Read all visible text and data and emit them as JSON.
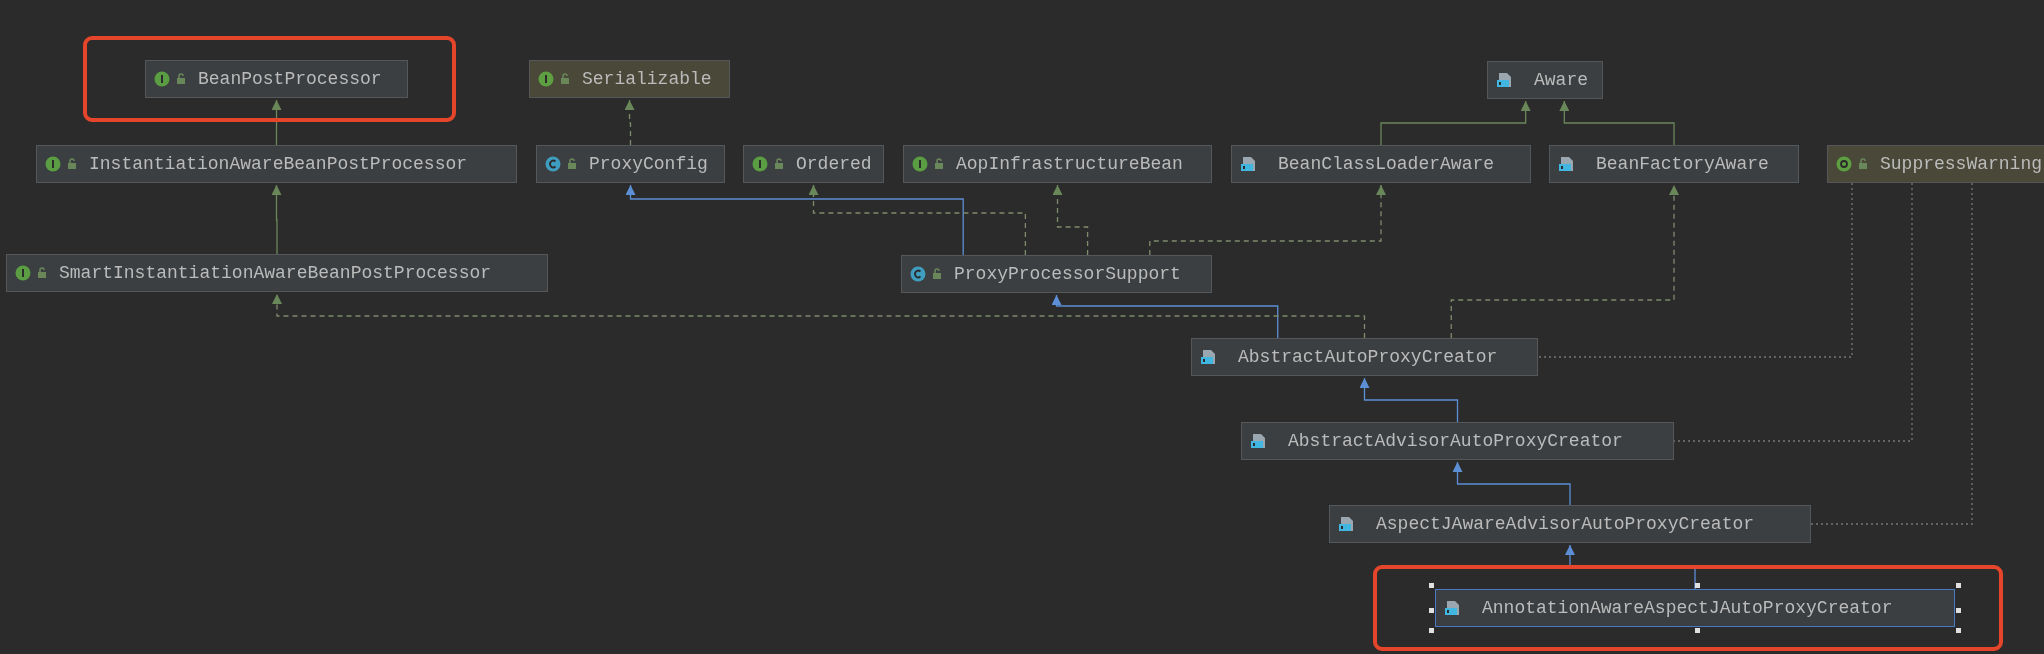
{
  "diagram": {
    "nodes": [
      {
        "name": "BeanPostProcessor",
        "kind": "interface",
        "color": "#3c3f41",
        "selected": false,
        "highlighted": true
      },
      {
        "name": "Serializable",
        "kind": "interface",
        "color": "#4a4839",
        "selected": false,
        "highlighted": false
      },
      {
        "name": "Aware",
        "kind": "binary",
        "color": "#3c3f41",
        "selected": false,
        "highlighted": false
      },
      {
        "name": "InstantiationAwareBeanPostProcessor",
        "kind": "interface",
        "color": "#3c3f41",
        "selected": false,
        "highlighted": false
      },
      {
        "name": "ProxyConfig",
        "kind": "class",
        "color": "#3c3f41",
        "selected": false,
        "highlighted": false
      },
      {
        "name": "Ordered",
        "kind": "interface",
        "color": "#3c3f41",
        "selected": false,
        "highlighted": false
      },
      {
        "name": "AopInfrastructureBean",
        "kind": "interface",
        "color": "#3c3f41",
        "selected": false,
        "highlighted": false
      },
      {
        "name": "BeanClassLoaderAware",
        "kind": "binary",
        "color": "#3c3f41",
        "selected": false,
        "highlighted": false
      },
      {
        "name": "BeanFactoryAware",
        "kind": "binary",
        "color": "#3c3f41",
        "selected": false,
        "highlighted": false
      },
      {
        "name": "SuppressWarning",
        "kind": "annotation",
        "color": "#4a4839",
        "selected": false,
        "highlighted": false
      },
      {
        "name": "SmartInstantiationAwareBeanPostProcessor",
        "kind": "interface",
        "color": "#3c3f41",
        "selected": false,
        "highlighted": false
      },
      {
        "name": "ProxyProcessorSupport",
        "kind": "class",
        "color": "#3c3f41",
        "selected": false,
        "highlighted": false
      },
      {
        "name": "AbstractAutoProxyCreator",
        "kind": "binary",
        "color": "#3c3f41",
        "selected": false,
        "highlighted": false
      },
      {
        "name": "AbstractAdvisorAutoProxyCreator",
        "kind": "binary",
        "color": "#3c3f41",
        "selected": false,
        "highlighted": false
      },
      {
        "name": "AspectJAwareAdvisorAutoProxyCreator",
        "kind": "binary",
        "color": "#3c3f41",
        "selected": false,
        "highlighted": false
      },
      {
        "name": "AnnotationAwareAspectJAutoProxyCreator",
        "kind": "binary",
        "color": "#3c3f41",
        "selected": true,
        "highlighted": true
      }
    ]
  }
}
